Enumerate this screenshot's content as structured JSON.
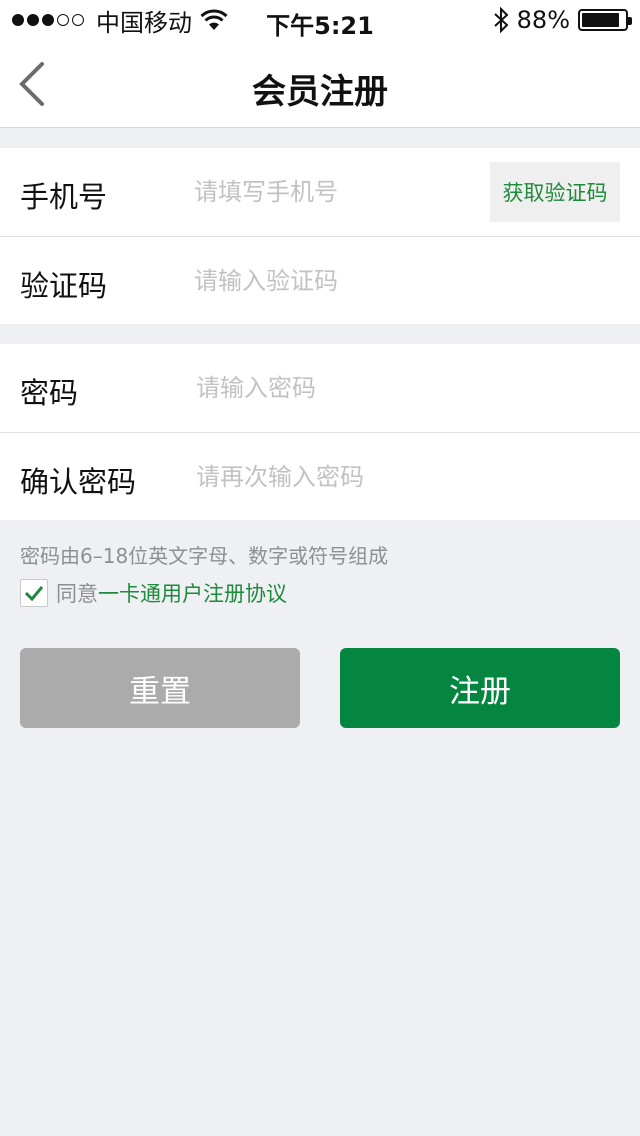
{
  "status_bar": {
    "carrier": "中国移动",
    "time": "下午5:21",
    "battery": "88%",
    "battery_level": 0.88,
    "signal_bars_filled": 3,
    "signal_bars_total": 5,
    "icons": [
      "wifi-icon",
      "bluetooth-icon",
      "battery-icon"
    ]
  },
  "nav": {
    "title": "会员注册",
    "back_icon": "chevron-left-icon"
  },
  "form": {
    "phone": {
      "label": "手机号",
      "placeholder": "请填写手机号",
      "value": ""
    },
    "get_code_label": "获取验证码",
    "code": {
      "label": "验证码",
      "placeholder": "请输入验证码",
      "value": ""
    },
    "password": {
      "label": "密码",
      "placeholder": "请输入密码",
      "value": ""
    },
    "confirm_password": {
      "label": "确认密码",
      "placeholder": "请再次输入密码",
      "value": ""
    }
  },
  "hint": "密码由6–18位英文字母、数字或符号组成",
  "agreement": {
    "checked": true,
    "prefix": "同意",
    "link_text": "一卡通用户注册协议"
  },
  "buttons": {
    "reset": "重置",
    "submit": "注册"
  },
  "colors": {
    "accent_green": "#058640",
    "link_green": "#1e8a3c",
    "reset_gray": "#ababab",
    "background": "#eff0f4",
    "placeholder": "#c2c2c2"
  }
}
